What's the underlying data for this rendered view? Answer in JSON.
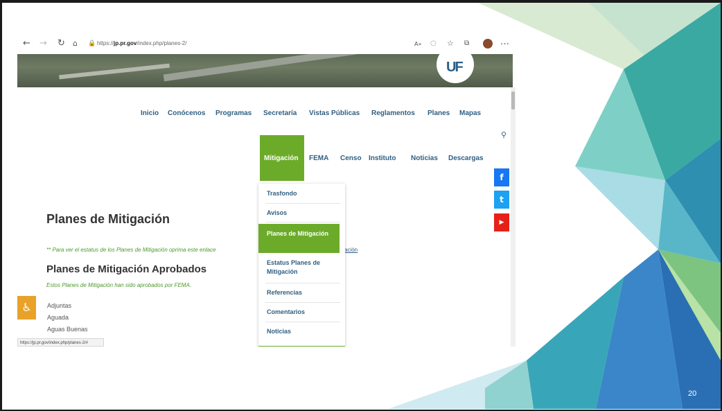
{
  "slide": {
    "number": "20"
  },
  "browser": {
    "url_prefix": "https://",
    "url_domain": "jp.pr.gov",
    "url_path": "/index.php/planes-2/",
    "status_url": "https://jp.pr.gov/index.php/planes-2/#",
    "icons": {
      "back": "back-arrow-icon",
      "forward": "forward-arrow-icon",
      "refresh": "refresh-icon",
      "home": "home-icon",
      "lock": "lock-icon",
      "read_aloud": "read-aloud-icon",
      "tracking": "tracking-icon",
      "favorite": "favorite-star-icon",
      "collections": "collections-icon",
      "profile": "profile-avatar",
      "more": "more-icon"
    }
  },
  "site": {
    "logo_text": "UF",
    "nav_row1": [
      "Inicio",
      "Conócenos",
      "Programas",
      "Secretaría",
      "Vistas Públicas",
      "Reglamentos",
      "Planes",
      "Mapas"
    ],
    "nav_row2": [
      "Mitigación",
      "FEMA",
      "Censo",
      "Instituto",
      "Noticias",
      "Descargas"
    ],
    "dropdown": [
      "Trasfondo",
      "Avisos",
      "Planes de Mitigación",
      "Estatus Planes de Mitigación",
      "Referencias",
      "Comentarios",
      "Noticias"
    ],
    "page_title": "Planes de Mitigación",
    "notice": "** Para ver el estatus de los Planes de Mitigación oprima este enlace",
    "notice_link": "ación",
    "section_title": "Planes de Mitigación Aprobados",
    "section_note": "Estos Planes de Mitigación han sido aprobados por FEMA.",
    "municipalities": [
      "Adjuntas",
      "Aguada",
      "Aguas Buenas"
    ],
    "social": {
      "facebook": "f",
      "twitter": "t",
      "youtube": "▶"
    },
    "colors": {
      "accent": "#6cab2a",
      "nav": "#2f5f82",
      "facebook": "#1877f2",
      "twitter": "#1da1f2",
      "youtube": "#e62117",
      "accessibility": "#e9a229"
    }
  }
}
